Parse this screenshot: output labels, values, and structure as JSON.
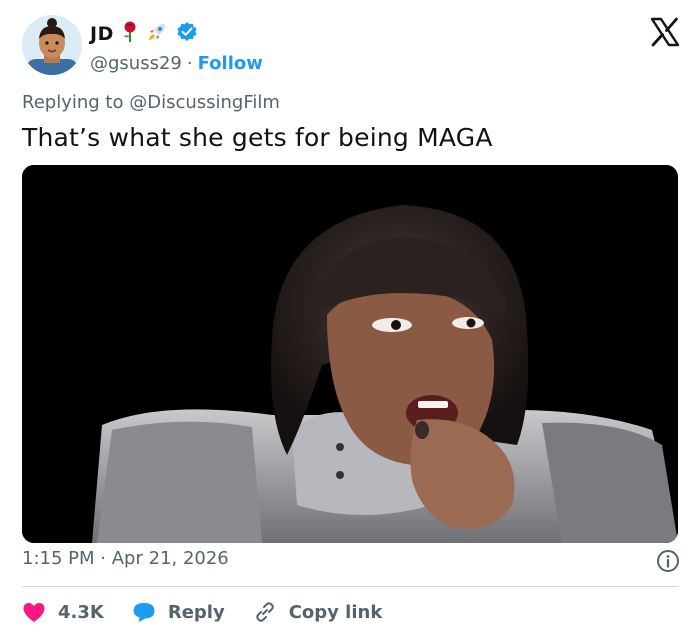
{
  "author": {
    "name": "JD",
    "handle": "@gsuss29",
    "separator": "·",
    "follow_label": "Follow",
    "emojis": [
      "rose-emoji",
      "rocket-emoji"
    ],
    "verified": true
  },
  "reply": {
    "prefix": "Replying to",
    "mention": "@DiscussingFilm"
  },
  "tweet": {
    "text": "That’s what she gets for being MAGA",
    "time": "1:15 PM",
    "separator": "·",
    "date": "Apr 21, 2026"
  },
  "actions": {
    "likes": "4.3K",
    "reply_label": "Reply",
    "copy_label": "Copy link"
  },
  "colors": {
    "accent": "#1d9bf0",
    "like": "#f91880",
    "muted": "#536471",
    "text": "#0f1419"
  },
  "icons": [
    "avatar",
    "x-logo-icon",
    "verified-badge-icon",
    "info-icon",
    "heart-icon",
    "reply-bubble-icon",
    "link-icon"
  ]
}
